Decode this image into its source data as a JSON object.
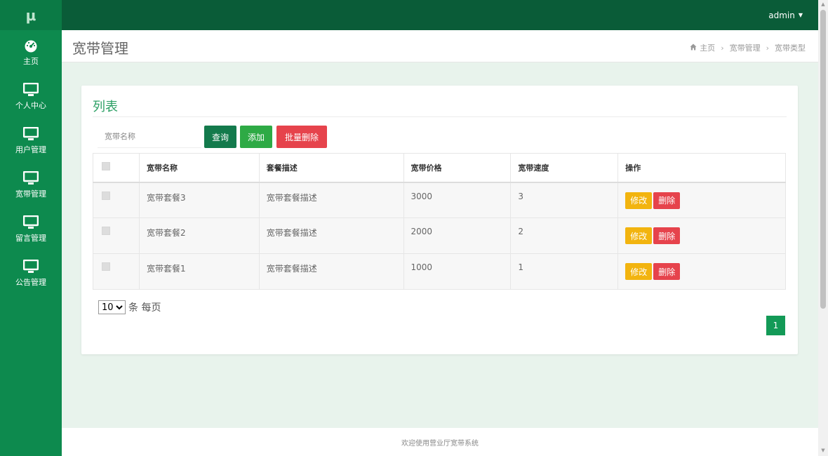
{
  "brand": {
    "logo": "μ"
  },
  "sidebar": {
    "items": [
      {
        "label": "主页",
        "icon": "dashboard-icon"
      },
      {
        "label": "个人中心",
        "icon": "monitor-icon"
      },
      {
        "label": "用户管理",
        "icon": "monitor-icon"
      },
      {
        "label": "宽带管理",
        "icon": "monitor-icon"
      },
      {
        "label": "留言管理",
        "icon": "monitor-icon"
      },
      {
        "label": "公告管理",
        "icon": "monitor-icon"
      }
    ]
  },
  "topbar": {
    "user": "admin"
  },
  "header": {
    "title": "宽带管理",
    "breadcrumb": [
      "主页",
      "宽带管理",
      "宽带类型"
    ]
  },
  "card": {
    "title": "列表",
    "search_placeholder": "宽带名称",
    "query_label": "查询",
    "add_label": "添加",
    "batch_delete_label": "批量删除"
  },
  "table": {
    "columns": [
      "宽带名称",
      "套餐描述",
      "宽带价格",
      "宽带速度",
      "操作"
    ],
    "rows": [
      {
        "name": "宽带套餐3",
        "desc": "宽带套餐描述",
        "price": "3000",
        "speed": "3"
      },
      {
        "name": "宽带套餐2",
        "desc": "宽带套餐描述",
        "price": "2000",
        "speed": "2"
      },
      {
        "name": "宽带套餐1",
        "desc": "宽带套餐描述",
        "price": "1000",
        "speed": "1"
      }
    ],
    "edit_label": "修改",
    "delete_label": "删除"
  },
  "pagination": {
    "page_size": "10",
    "page_size_suffix": "条 每页",
    "current_page": "1"
  },
  "footer": {
    "text": "欢迎使用营业厅宽带系统"
  },
  "colors": {
    "sidebar": "#0d8a4e",
    "topbar": "#0a5c38",
    "accent": "#2da065",
    "warning": "#f2b40f",
    "danger": "#e6434c"
  }
}
